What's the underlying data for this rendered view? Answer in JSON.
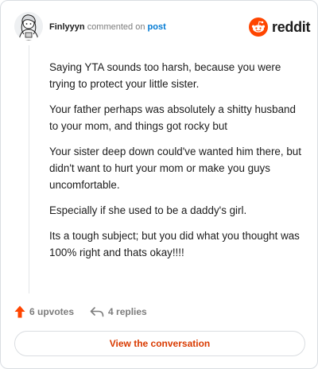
{
  "header": {
    "username": "Finlyyyn",
    "action_text": "commented on",
    "target_label": "post"
  },
  "brand": {
    "wordmark": "reddit",
    "color": "#ff4500"
  },
  "comment": {
    "paragraphs": [
      "Saying YTA sounds too harsh, because you were trying to protect your little sister.",
      "Your father perhaps was absolutely a shitty husband to your mom, and things got rocky but",
      "Your sister deep down could've wanted him there, but didn't want to hurt your mom or make you guys uncomfortable.",
      "Especially if she used to be a daddy's girl.",
      "Its a tough subject; but you did what you thought was 100% right and thats okay!!!!"
    ]
  },
  "actions": {
    "upvotes_label": "6 upvotes",
    "upvote_icon": "arrow-up-icon",
    "upvote_color": "#ff4500",
    "replies_label": "4 replies",
    "reply_icon": "reply-arrow-icon"
  },
  "cta": {
    "label": "View the conversation",
    "color": "#d93a00"
  }
}
